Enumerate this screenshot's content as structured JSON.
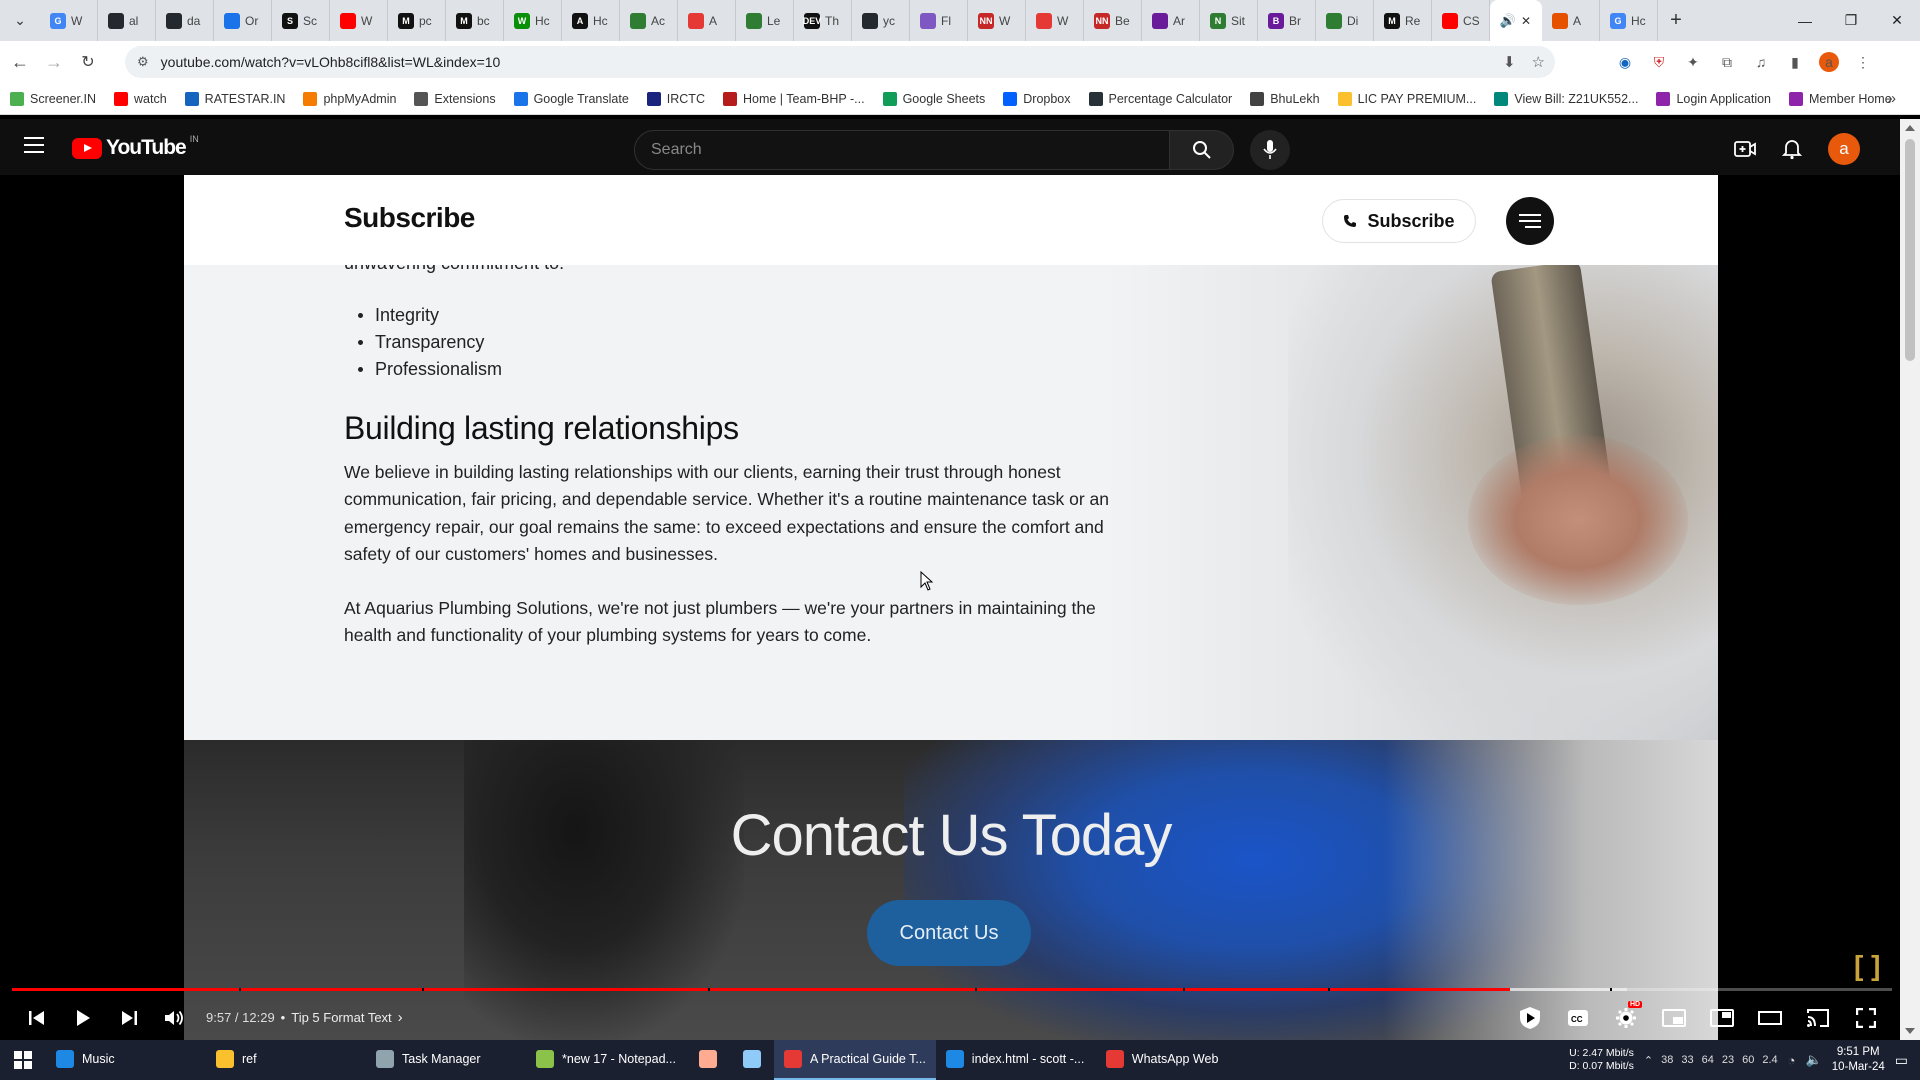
{
  "browser": {
    "tabs": [
      {
        "letter": "G",
        "label": "W",
        "color": "#4285f4"
      },
      {
        "letter": "",
        "label": "al",
        "color": "#24292f"
      },
      {
        "letter": "",
        "label": "da",
        "color": "#24292f"
      },
      {
        "letter": "",
        "label": "Or",
        "color": "#1a73e8"
      },
      {
        "letter": "S",
        "label": "Sc",
        "color": "#111111"
      },
      {
        "letter": "",
        "label": "W",
        "color": "#ff0000"
      },
      {
        "letter": "M",
        "label": "pc",
        "color": "#111111"
      },
      {
        "letter": "M",
        "label": "bc",
        "color": "#111111"
      },
      {
        "letter": "W",
        "label": "Hc",
        "color": "#0a8f08"
      },
      {
        "letter": "A",
        "label": "Hc",
        "color": "#111111"
      },
      {
        "letter": "",
        "label": "Ac",
        "color": "#2e7d32"
      },
      {
        "letter": "",
        "label": "A",
        "color": "#e53935"
      },
      {
        "letter": "",
        "label": "Le",
        "color": "#2e7d32"
      },
      {
        "letter": "DEV",
        "label": "Th",
        "color": "#111111"
      },
      {
        "letter": "",
        "label": "yc",
        "color": "#24292f"
      },
      {
        "letter": "",
        "label": "Fl",
        "color": "#7e57c2"
      },
      {
        "letter": "NN",
        "label": "W",
        "color": "#c62828"
      },
      {
        "letter": "",
        "label": "W",
        "color": "#e53935"
      },
      {
        "letter": "NN",
        "label": "Be",
        "color": "#c62828"
      },
      {
        "letter": "",
        "label": "Ar",
        "color": "#6a1b9a"
      },
      {
        "letter": "N",
        "label": "Sit",
        "color": "#2e7d32"
      },
      {
        "letter": "B",
        "label": "Br",
        "color": "#6a1b9a"
      },
      {
        "letter": "",
        "label": "Di",
        "color": "#2e7d32"
      },
      {
        "letter": "M",
        "label": "Re",
        "color": "#111111"
      },
      {
        "letter": "",
        "label": "CS",
        "color": "#ff0000"
      }
    ],
    "active_tab_close": "✕",
    "after_tabs": [
      {
        "letter": "",
        "label": "A",
        "color": "#e65100"
      },
      {
        "letter": "G",
        "label": "Hc",
        "color": "#4285f4"
      }
    ],
    "new_tab": "+",
    "url": "youtube.com/watch?v=vLOhb8cifl8&list=WL&index=10",
    "bookmarks": [
      {
        "label": "Screener.IN",
        "color": "#4caf50"
      },
      {
        "label": "watch",
        "color": "#ff0000"
      },
      {
        "label": "RATESTAR.IN",
        "color": "#1565c0"
      },
      {
        "label": "phpMyAdmin",
        "color": "#f57c00"
      },
      {
        "label": "Extensions",
        "color": "#555555"
      },
      {
        "label": "Google Translate",
        "color": "#1a73e8"
      },
      {
        "label": "IRCTC",
        "color": "#1a237e"
      },
      {
        "label": "Home | Team-BHP -...",
        "color": "#b71c1c"
      },
      {
        "label": "Google Sheets",
        "color": "#0f9d58"
      },
      {
        "label": "Dropbox",
        "color": "#0061ff"
      },
      {
        "label": "Percentage Calculator",
        "color": "#263238"
      },
      {
        "label": "BhuLekh",
        "color": "#424242"
      },
      {
        "label": "LIC PAY PREMIUM...",
        "color": "#fbc02d"
      },
      {
        "label": "View Bill: Z21UK552...",
        "color": "#00897b"
      },
      {
        "label": "Login Application",
        "color": "#8e24aa"
      },
      {
        "label": "Member Home",
        "color": "#8e24aa"
      }
    ],
    "bookmarks_more": "»"
  },
  "youtube": {
    "logo_word": "YouTube",
    "country": "IN",
    "search_placeholder": "Search",
    "avatar_letter": "a"
  },
  "site": {
    "brand": "Subscribe",
    "subscribe_button": "Subscribe",
    "cut_text": "unwavering commitment to:",
    "values": [
      "Integrity",
      "Transparency",
      "Professionalism"
    ],
    "heading": "Building lasting relationships",
    "para1": "We believe in building lasting relationships with our clients, earning their trust through honest communication, fair pricing, and dependable service. Whether it's a routine maintenance task or an emergency repair, our goal remains the same: to exceed expectations and ensure the comfort and safety of our customers' homes and businesses.",
    "para2": "At Aquarius Plumbing Solutions, we're not just plumbers — we're your partners in maintaining the health and functionality of your plumbing systems for years to come.",
    "contact_title": "Contact Us Today",
    "contact_button": "Contact Us"
  },
  "player": {
    "time": "9:57 / 12:29",
    "separator": "•",
    "chapter": "Tip 5 Format Text",
    "played_fraction": 0.797,
    "corner_mark": "[ ]"
  },
  "taskbar": {
    "items": [
      {
        "label": "Music",
        "color": "#1e88e5",
        "active": false
      },
      {
        "label": "ref",
        "color": "#fbc02d",
        "active": false
      },
      {
        "label": "Task Manager",
        "color": "#90a4ae",
        "active": false
      },
      {
        "label": "*new 17 - Notepad...",
        "color": "#8bc34a",
        "active": false
      },
      {
        "label": "",
        "color": "#ffab91",
        "active": false
      },
      {
        "label": "",
        "color": "#90caf9",
        "active": false
      },
      {
        "label": "A Practical Guide T...",
        "color": "#e53935",
        "active": true
      },
      {
        "label": "index.html - scott -...",
        "color": "#1e88e5",
        "active": false
      },
      {
        "label": "WhatsApp Web",
        "color": "#e53935",
        "active": false
      }
    ],
    "net_up_label": "U:",
    "net_up": "2.47 Mbit/s",
    "net_down_label": "D:",
    "net_down": "0.07 Mbit/s",
    "tray_numbers": [
      "38",
      "33",
      "64",
      "23",
      "60",
      "2.4"
    ],
    "time": "9:51 PM",
    "date": "10-Mar-24"
  }
}
